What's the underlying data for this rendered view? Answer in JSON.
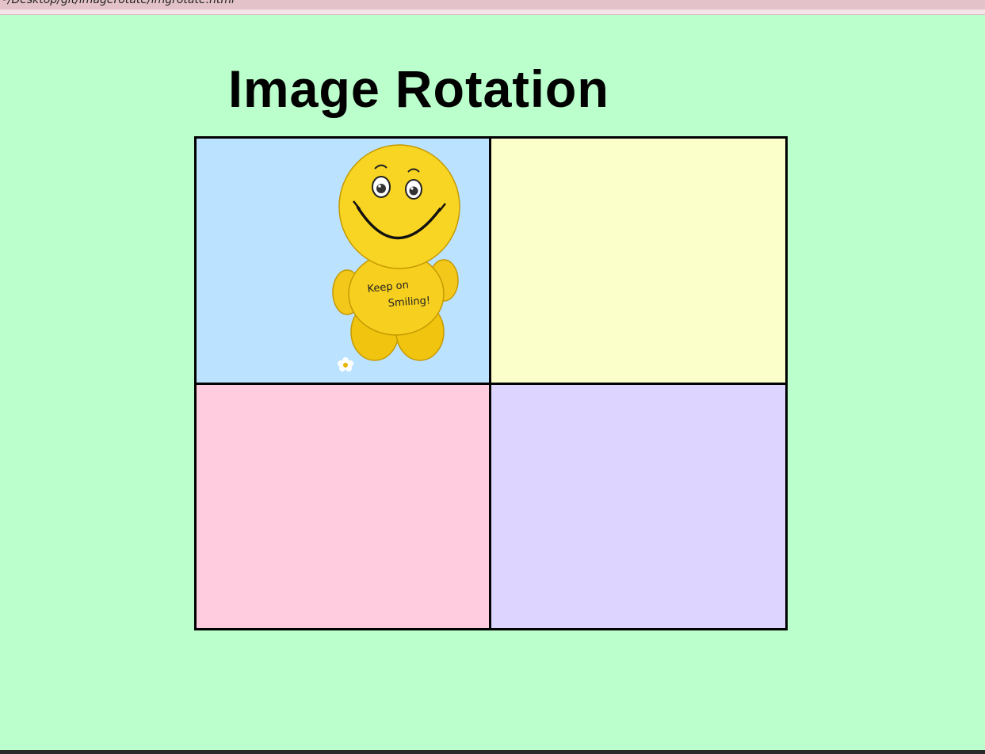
{
  "browser": {
    "address": "~/Desktop/git/imagerotate/imgrotate.html"
  },
  "page": {
    "title": "Image Rotation"
  },
  "grid": {
    "cells": [
      {
        "id": "top-left",
        "color": "#bbe2ff",
        "content": "smiley-toy-image"
      },
      {
        "id": "top-right",
        "color": "#fbffca",
        "content": ""
      },
      {
        "id": "bottom-left",
        "color": "#ffccdf",
        "content": ""
      },
      {
        "id": "bottom-right",
        "color": "#ddd4ff",
        "content": ""
      }
    ]
  },
  "image": {
    "caption_line1": "Keep on",
    "caption_line2": "Smiling!"
  },
  "colors": {
    "background": "#bbffcc",
    "border": "#000000"
  }
}
